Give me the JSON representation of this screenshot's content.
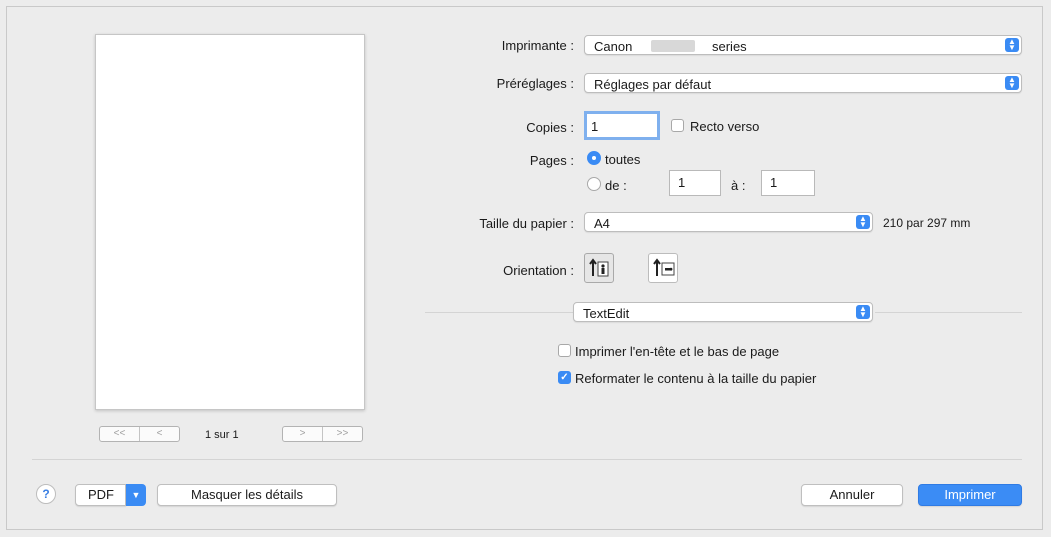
{
  "preview": {
    "page_info": "1 sur 1",
    "first_label": "<<",
    "prev_label": "<",
    "next_label": ">",
    "last_label": ">>"
  },
  "printer": {
    "label": "Imprimante :",
    "value_prefix": "Canon",
    "value_suffix": "series"
  },
  "presets": {
    "label": "Préréglages :",
    "value": "Réglages par défaut"
  },
  "copies": {
    "label": "Copies :",
    "value": "1",
    "duplex_label": "Recto verso",
    "duplex_checked": false
  },
  "pages": {
    "label": "Pages :",
    "all_label": "toutes",
    "from_label": "de :",
    "from_value": "1",
    "to_label": "à :",
    "to_value": "1"
  },
  "paper_size": {
    "label": "Taille du papier :",
    "value": "A4",
    "dimensions": "210 par 297 mm"
  },
  "orientation": {
    "label": "Orientation :"
  },
  "app_menu": {
    "value": "TextEdit"
  },
  "options": {
    "header_footer_label": "Imprimer l'en-tête et le bas de page",
    "header_footer_checked": false,
    "rewrap_label": "Reformater le contenu à la taille du papier",
    "rewrap_checked": true
  },
  "footer": {
    "help_label": "?",
    "pdf_label": "PDF",
    "hide_details_label": "Masquer les détails",
    "cancel_label": "Annuler",
    "print_label": "Imprimer"
  },
  "colors": {
    "accent": "#3a8bf4",
    "window_bg": "#ececec"
  }
}
